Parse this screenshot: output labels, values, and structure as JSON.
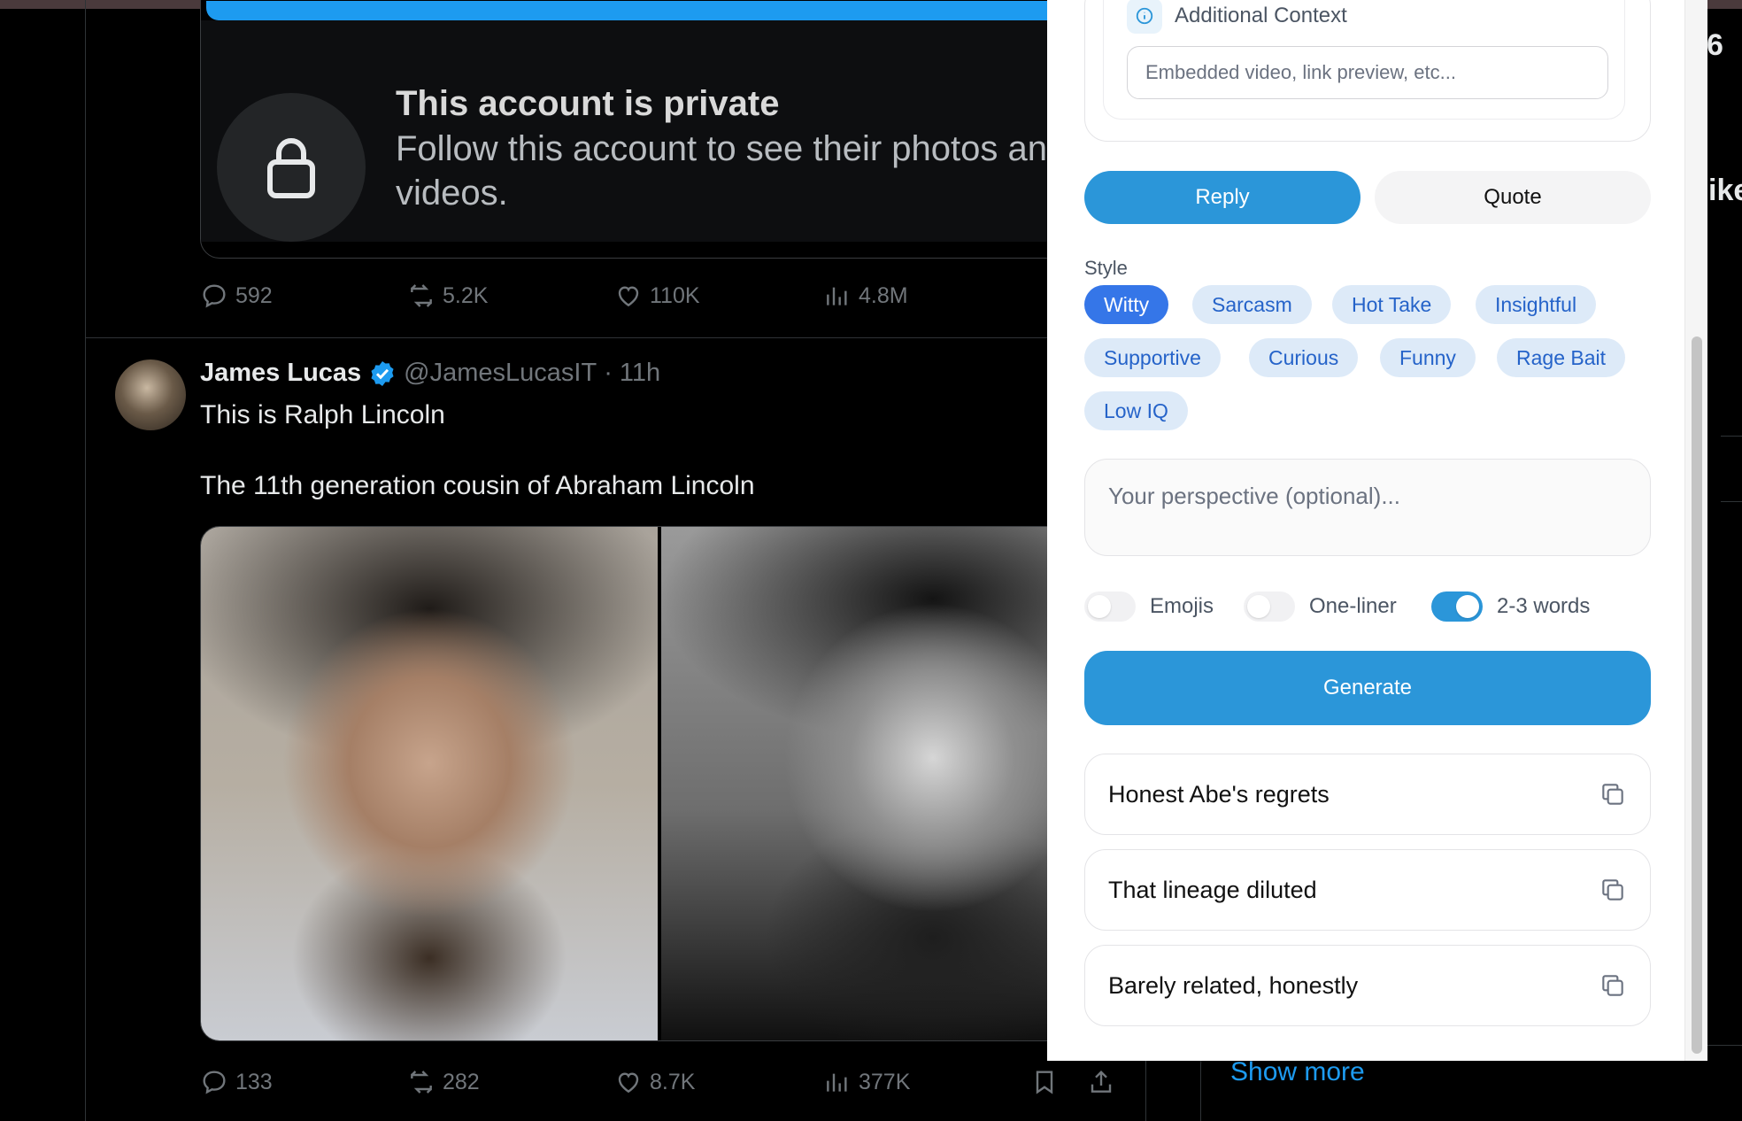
{
  "feed": {
    "private_card": {
      "title": "This account is private",
      "subtitle": "Follow this account to see their photos and videos."
    },
    "tweet1_actions": {
      "replies": "592",
      "retweets": "5.2K",
      "likes": "110K",
      "views": "4.8M"
    },
    "tweet2": {
      "author_name": "James Lucas",
      "handle": "@JamesLucasIT",
      "time": "· 11h",
      "text_line1": "This is Ralph Lincoln",
      "text_line2": "The 11th generation cousin of Abraham Lincoln",
      "actions": {
        "replies": "133",
        "retweets": "282",
        "likes": "8.7K",
        "views": "377K"
      }
    },
    "sidebar": {
      "fragment_top": "6",
      "fragment_mid": "ike",
      "show_more": "Show more"
    }
  },
  "panel": {
    "additional_context": {
      "title": "Additional Context",
      "placeholder": "Embedded video, link preview, etc..."
    },
    "modes": {
      "reply": "Reply",
      "quote": "Quote",
      "active": "reply"
    },
    "style": {
      "label": "Style",
      "chips": [
        "Witty",
        "Sarcasm",
        "Hot Take",
        "Insightful",
        "Supportive",
        "Curious",
        "Funny",
        "Rage Bait",
        "Low IQ"
      ],
      "selected": "Witty"
    },
    "perspective_placeholder": "Your perspective (optional)...",
    "toggles": [
      {
        "label": "Emojis",
        "on": false
      },
      {
        "label": "One-liner",
        "on": false
      },
      {
        "label": "2-3 words",
        "on": true
      }
    ],
    "generate_label": "Generate",
    "results": [
      "Honest Abe's regrets",
      "That lineage diluted",
      "Barely related, honestly"
    ]
  },
  "colors": {
    "accent": "#2b96d9",
    "chip_bg": "#ddeaf8",
    "chip_text": "#2563c9",
    "chip_active": "#3576e8",
    "link_blue": "#1d9bf0"
  },
  "icons": [
    "lock-icon",
    "reply-icon",
    "retweet-icon",
    "like-icon",
    "views-icon",
    "bookmark-icon",
    "share-icon",
    "verified-icon",
    "info-icon",
    "copy-icon"
  ]
}
